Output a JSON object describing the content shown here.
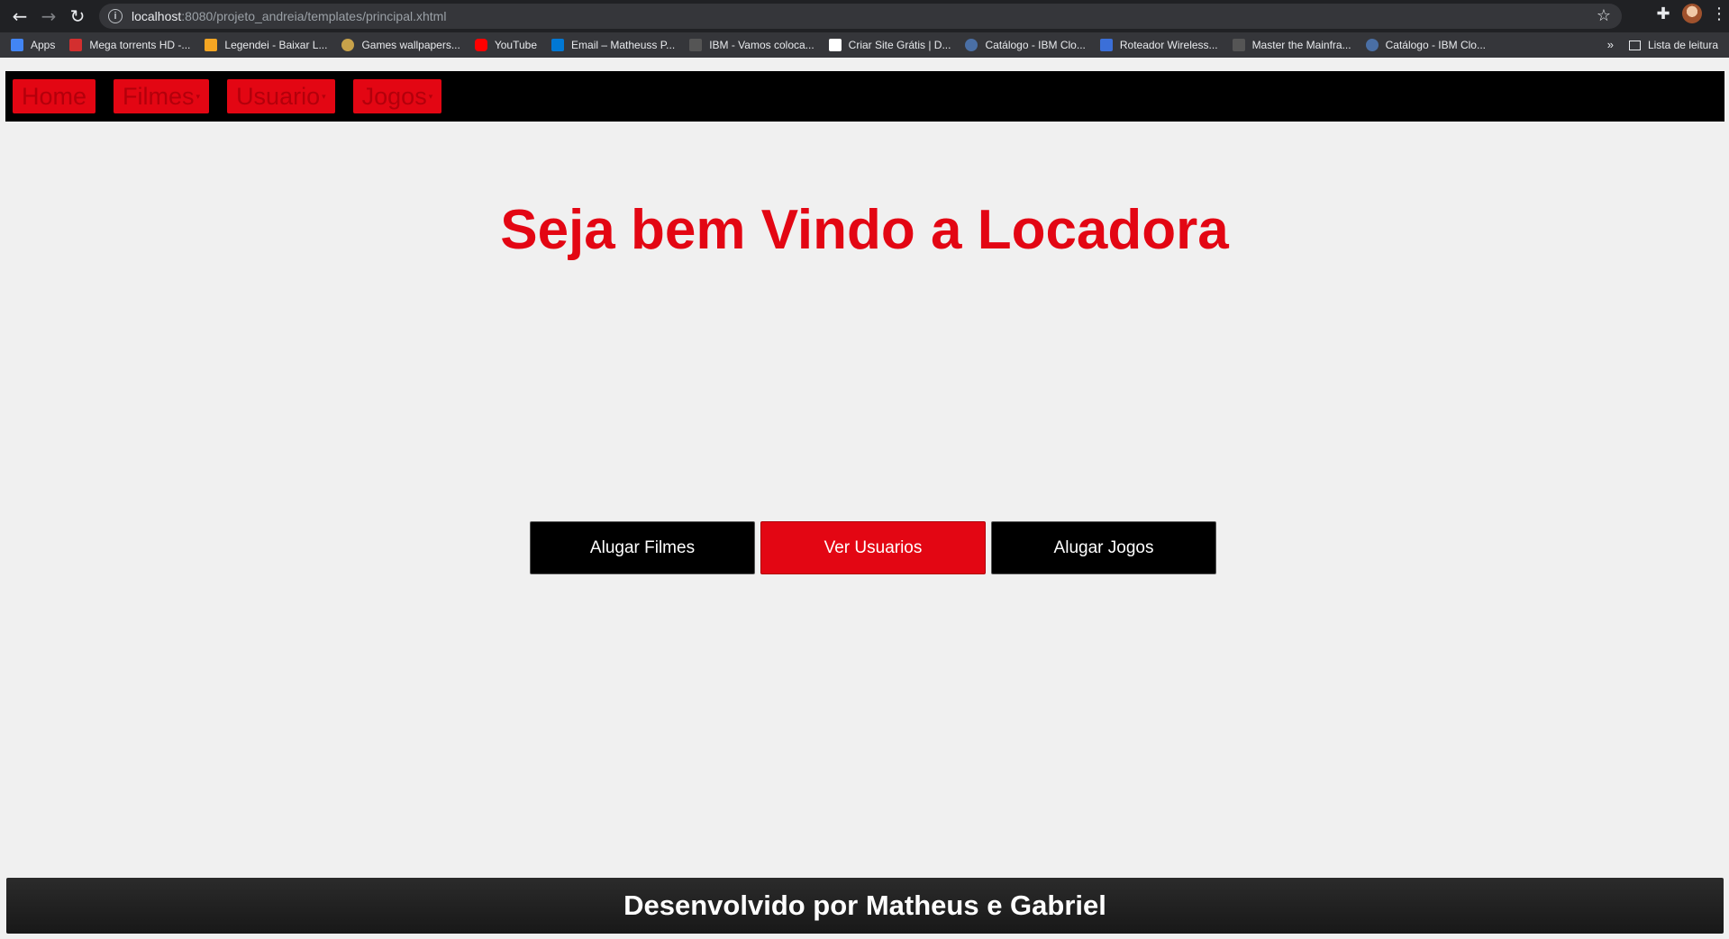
{
  "browser": {
    "back_icon": "←",
    "forward_icon": "→",
    "reload_icon": "↻",
    "info_icon": "i",
    "url_host": "localhost",
    "url_rest": ":8080/projeto_andreia/templates/principal.xhtml",
    "star_icon": "☆",
    "extensions_icon": "✚",
    "menu_icon": "⋮",
    "bookmarks": [
      {
        "label": "Apps",
        "color": "#4285f4"
      },
      {
        "label": "Mega torrents HD -...",
        "color": "#d32f2f"
      },
      {
        "label": "Legendei - Baixar L...",
        "color": "#f5a623"
      },
      {
        "label": "Games wallpapers...",
        "color": "#c8a24a"
      },
      {
        "label": "YouTube",
        "color": "#ff0000"
      },
      {
        "label": "Email – Matheuss P...",
        "color": "#0078d4"
      },
      {
        "label": "IBM - Vamos coloca...",
        "color": "#555555"
      },
      {
        "label": "Criar Site Grátis | D...",
        "color": "#ffffff"
      },
      {
        "label": "Catálogo - IBM Clo...",
        "color": "#4a6fa5"
      },
      {
        "label": "Roteador Wireless...",
        "color": "#3b6fd8"
      },
      {
        "label": "Master the Mainfra...",
        "color": "#555555"
      },
      {
        "label": "Catálogo - IBM Clo...",
        "color": "#4a6fa5"
      }
    ],
    "more_bookmarks": "»",
    "reading_list": "Lista de leitura"
  },
  "menu": {
    "items": [
      {
        "label": "Home",
        "dropdown": false
      },
      {
        "label": "Filmes",
        "dropdown": true
      },
      {
        "label": "Usuario",
        "dropdown": true
      },
      {
        "label": "Jogos",
        "dropdown": true
      }
    ],
    "caret": "▾"
  },
  "main": {
    "title": "Seja bem Vindo a Locadora",
    "buttons": {
      "alugar_filmes": "Alugar Filmes",
      "ver_usuarios": "Ver Usuarios",
      "alugar_jogos": "Alugar Jogos"
    }
  },
  "footer": {
    "text": "Desenvolvido por Matheus e Gabriel"
  },
  "colors": {
    "accent_red": "#e30613",
    "menu_bg": "#000000",
    "page_bg": "#f0f0f0"
  }
}
